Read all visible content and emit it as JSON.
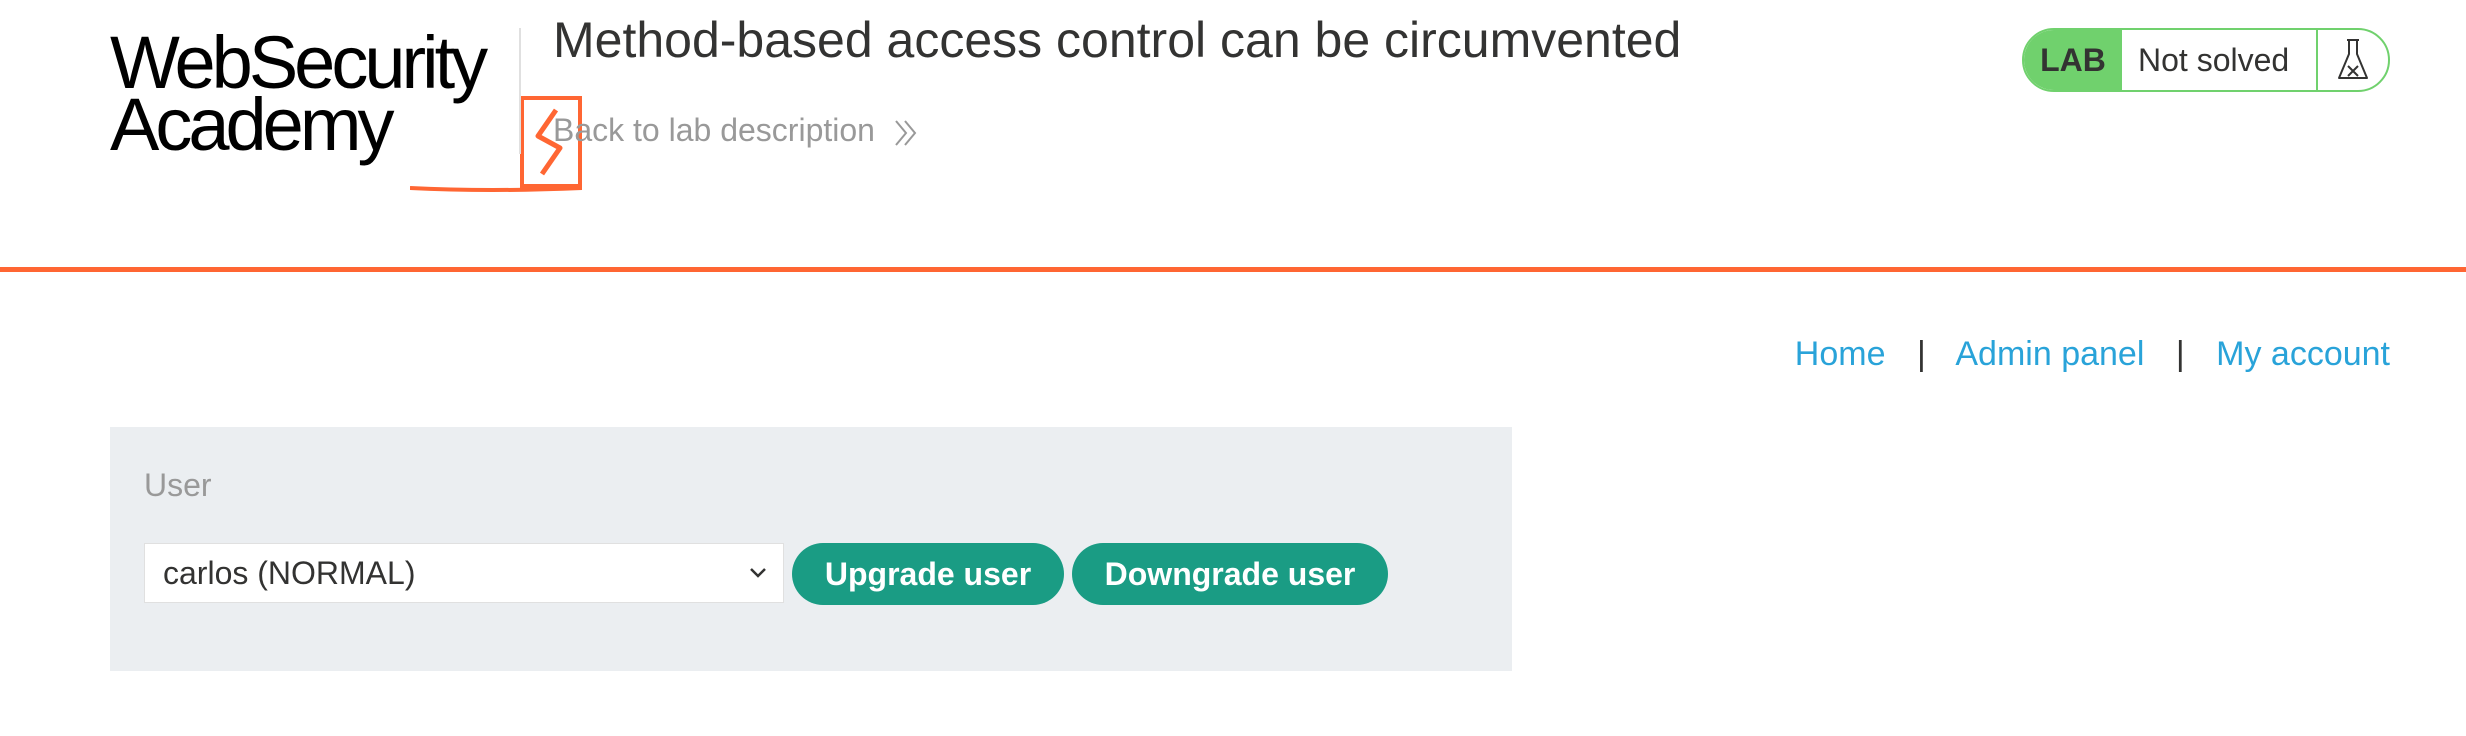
{
  "header": {
    "logo": {
      "line1": "WebSecurity",
      "line2": "Academy"
    },
    "title": "Method-based access control can be circumvented",
    "back_link": "Back to lab description",
    "status": {
      "badge": "LAB",
      "text": "Not solved",
      "icon": "flask-icon"
    }
  },
  "colors": {
    "accent": "#ff6633",
    "status": "#70d16d",
    "button": "#1a9c84",
    "link": "#29a3d9"
  },
  "nav": {
    "home": "Home",
    "admin": "Admin panel",
    "account": "My account",
    "separator": "|"
  },
  "form": {
    "label": "User",
    "selected_user": "carlos (NORMAL)",
    "upgrade_label": "Upgrade user",
    "downgrade_label": "Downgrade user"
  }
}
